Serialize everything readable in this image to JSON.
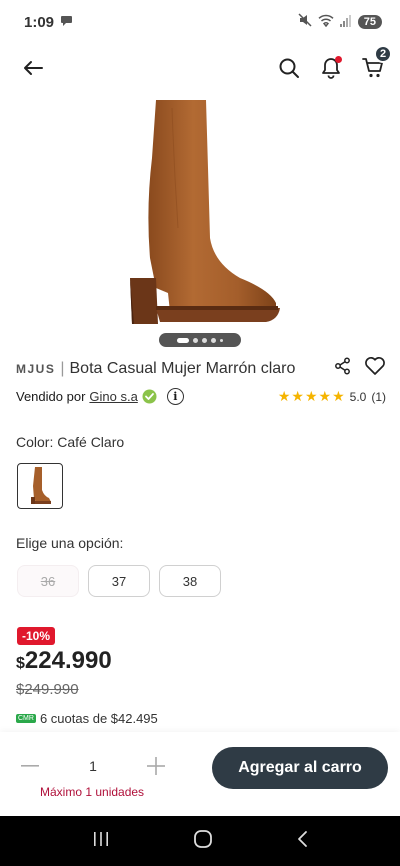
{
  "status": {
    "time": "1:09",
    "battery": "75"
  },
  "product": {
    "brand": "MJUS",
    "separator": "|",
    "title": "Bota Casual Mujer Marrón claro",
    "sold_by_label": "Vendido por",
    "seller": "Gino s.a",
    "rating_value": "5.0",
    "rating_count": "(1)",
    "stars": 5
  },
  "cart": {
    "count": "2"
  },
  "carousel": {
    "total_images": 4,
    "current": 1
  },
  "color": {
    "label": "Color: Café Claro"
  },
  "options": {
    "label": "Elige una opción:",
    "sizes": [
      {
        "value": "36",
        "available": false
      },
      {
        "value": "37",
        "available": true
      },
      {
        "value": "38",
        "available": true
      }
    ]
  },
  "pricing": {
    "discount": "-10%",
    "currency": "$",
    "price": "224.990",
    "old_price": "$249.990",
    "installments_badge": "CMR",
    "installments": "6 cuotas de $42.495"
  },
  "purchase": {
    "quantity": "1",
    "max_note": "Máximo 1 unidades",
    "add_to_cart": "Agregar al carro"
  },
  "colors": {
    "primary_button": "#2f3b45",
    "discount": "#e0182d",
    "star": "#f5b400",
    "max_note": "#b0103a",
    "boot": "#a65f2a"
  }
}
